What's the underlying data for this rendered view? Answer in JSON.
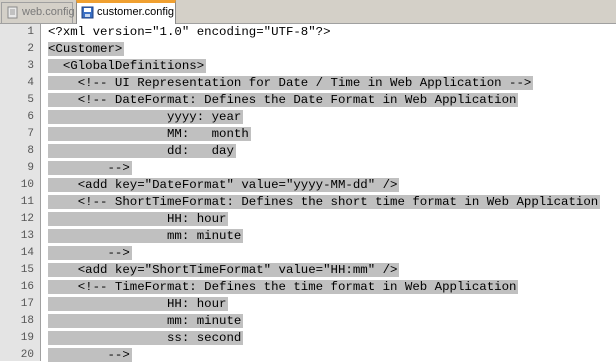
{
  "tabs": [
    {
      "label": "web.config",
      "active": false,
      "icon": "document-icon"
    },
    {
      "label": "customer.config",
      "active": true,
      "icon": "save-document-icon"
    }
  ],
  "editor": {
    "selection_color": "#c0c0c0",
    "lines": [
      {
        "num": "1",
        "text": "<?xml version=\"1.0\" encoding=\"UTF-8\"?>",
        "selected": false
      },
      {
        "num": "2",
        "text": "<Customer>",
        "selected": true
      },
      {
        "num": "3",
        "text": "  <GlobalDefinitions>",
        "selected": true
      },
      {
        "num": "4",
        "text": "    <!-- UI Representation for Date / Time in Web Application -->",
        "selected": true
      },
      {
        "num": "5",
        "text": "    <!-- DateFormat: Defines the Date Format in Web Application",
        "selected": true
      },
      {
        "num": "6",
        "text": "                yyyy: year",
        "selected": true
      },
      {
        "num": "7",
        "text": "                MM:   month",
        "selected": true
      },
      {
        "num": "8",
        "text": "                dd:   day",
        "selected": true
      },
      {
        "num": "9",
        "text": "        -->",
        "selected": true
      },
      {
        "num": "10",
        "text": "    <add key=\"DateFormat\" value=\"yyyy-MM-dd\" />",
        "selected": true
      },
      {
        "num": "11",
        "text": "    <!-- ShortTimeFormat: Defines the short time format in Web Application",
        "selected": true
      },
      {
        "num": "12",
        "text": "                HH: hour",
        "selected": true
      },
      {
        "num": "13",
        "text": "                mm: minute",
        "selected": true
      },
      {
        "num": "14",
        "text": "        -->",
        "selected": true
      },
      {
        "num": "15",
        "text": "    <add key=\"ShortTimeFormat\" value=\"HH:mm\" />",
        "selected": true
      },
      {
        "num": "16",
        "text": "    <!-- TimeFormat: Defines the time format in Web Application",
        "selected": true
      },
      {
        "num": "17",
        "text": "                HH: hour",
        "selected": true
      },
      {
        "num": "18",
        "text": "                mm: minute",
        "selected": true
      },
      {
        "num": "19",
        "text": "                ss: second",
        "selected": true
      },
      {
        "num": "20",
        "text": "        -->",
        "selected": true
      }
    ]
  }
}
